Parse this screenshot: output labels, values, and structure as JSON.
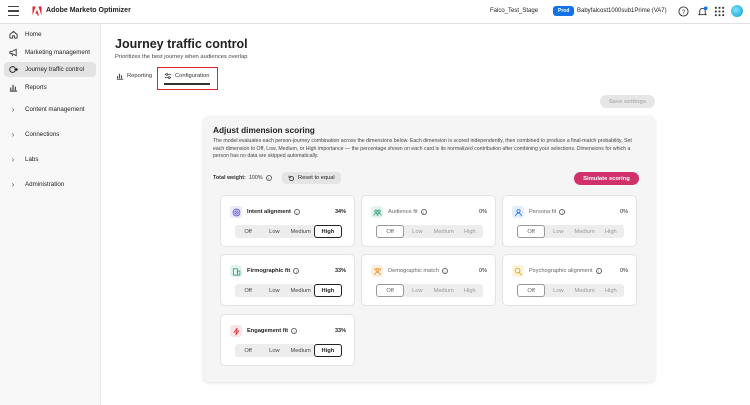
{
  "app": {
    "title": "Adobe Marketo Optimizer",
    "sandbox": "Falco_Test_Stage",
    "env_badge": "Prod",
    "org": "Babyfalcost1000sub1Prime (VA7)"
  },
  "icons": {
    "menu": "hamburger-icon",
    "logo": "adobe-logo",
    "help": "help-icon",
    "notifications": "bell-icon",
    "apps": "app-grid-icon",
    "avatar": "user-avatar"
  },
  "sidebar": {
    "items": [
      {
        "label": "Home",
        "icon": "home-icon"
      },
      {
        "label": "Marketing management",
        "icon": "megaphone-icon"
      },
      {
        "label": "Journey traffic control",
        "icon": "traffic-control-icon",
        "active": true
      },
      {
        "label": "Reports",
        "icon": "reports-icon"
      },
      {
        "label": "Content management",
        "icon": "chevron-right-icon"
      },
      {
        "label": "Connections",
        "icon": "chevron-right-icon"
      },
      {
        "label": "Labs",
        "icon": "chevron-right-icon"
      },
      {
        "label": "Administration",
        "icon": "chevron-right-icon"
      }
    ]
  },
  "page": {
    "title": "Journey traffic control",
    "subtitle": "Prioritizes the best journey when audiences overlap"
  },
  "tabs": [
    {
      "label": "Reporting",
      "icon": "chart-icon"
    },
    {
      "label": "Configuration",
      "icon": "sliders-icon",
      "selected": true
    }
  ],
  "save_label": "Save settings",
  "panel": {
    "title": "Adjust dimension scoring",
    "description": "The model evaluates each person-journey combination across the dimensions below. Each dimension is scored independently, then combined to produce a final-match probability. Set each dimension to Off, Low, Medium, or High importance — the percentage shown on each card is its normalized contribution after combining your selections. Dimensions for which a person has no data are skipped automatically.",
    "total_label": "Total weight:",
    "total_value": "100%",
    "reset_label": "Reset to equal",
    "simulate_label": "Simulate scoring"
  },
  "levels": [
    "Off",
    "Low",
    "Medium",
    "High"
  ],
  "cards": [
    {
      "title": "Intent alignment",
      "percent": "34%",
      "level": "High",
      "icon": "target-icon",
      "color": "#5a4fcf"
    },
    {
      "title": "Audience fit",
      "percent": "0%",
      "level": "Off",
      "icon": "audience-icon",
      "color": "#2d9d78"
    },
    {
      "title": "Persona fit",
      "percent": "0%",
      "level": "Off",
      "icon": "persona-icon",
      "color": "#1473e6"
    },
    {
      "title": "Firmographic fit",
      "percent": "33%",
      "level": "High",
      "icon": "building-icon",
      "color": "#2d9d78"
    },
    {
      "title": "Demographic match",
      "percent": "0%",
      "level": "Off",
      "icon": "demographic-icon",
      "color": "#e68619"
    },
    {
      "title": "Psychographic alignment",
      "percent": "0%",
      "level": "Off",
      "icon": "psychographic-icon",
      "color": "#d4a000"
    },
    {
      "title": "Engagement fit",
      "percent": "33%",
      "level": "High",
      "icon": "engagement-icon",
      "color": "#d7373f"
    }
  ]
}
